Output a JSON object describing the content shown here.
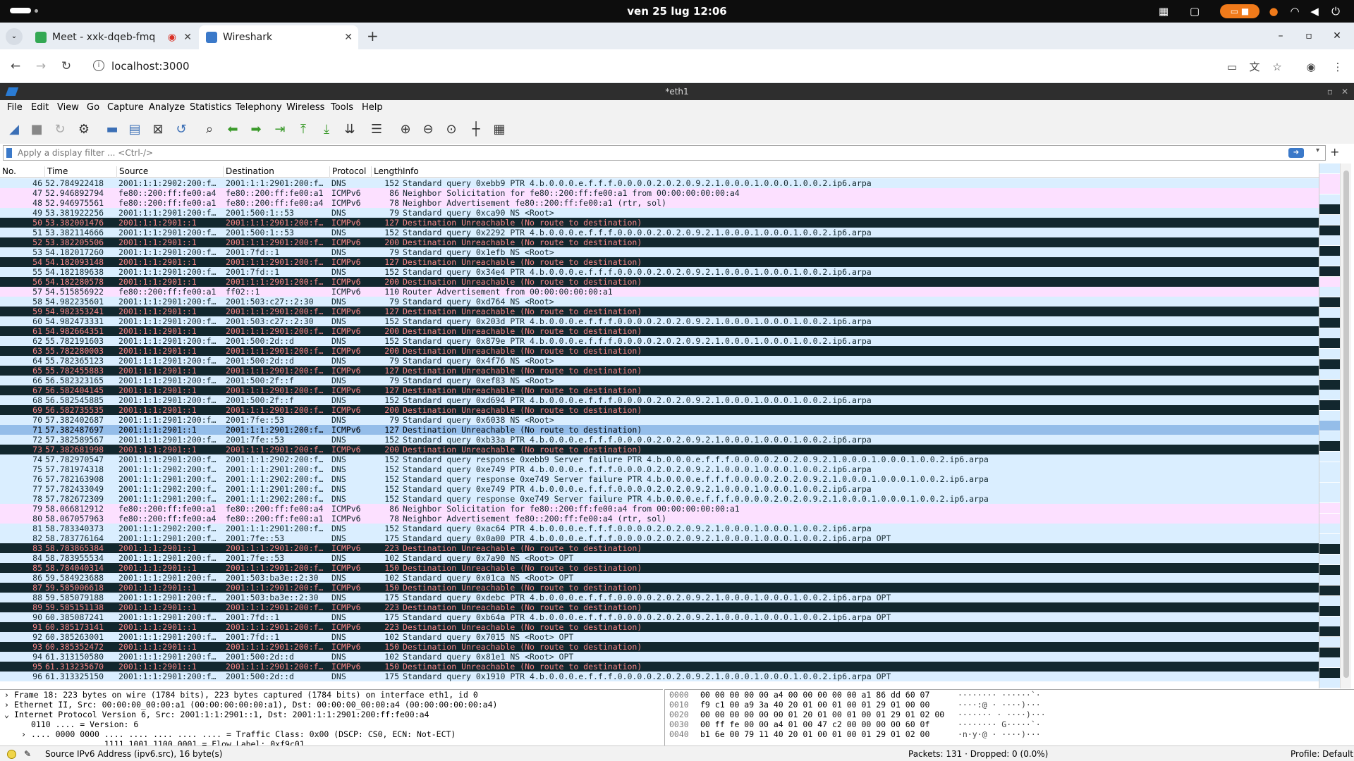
{
  "system": {
    "clock": "ven 25 lug  12:06"
  },
  "browser": {
    "tabs": [
      {
        "label": "Meet - xxk-dqeb-fmq",
        "color": "#34a853",
        "recording": true
      },
      {
        "label": "Wireshark",
        "color": "#3b79c9",
        "recording": false
      }
    ],
    "url": "localhost:3000"
  },
  "wireshark": {
    "title": "*eth1",
    "menu": [
      "File",
      "Edit",
      "View",
      "Go",
      "Capture",
      "Analyze",
      "Statistics",
      "Telephony",
      "Wireless",
      "Tools",
      "Help"
    ],
    "filter_placeholder": "Apply a display filter ... <Ctrl-/>",
    "columns": [
      "No.",
      "Time",
      "Source",
      "Destination",
      "Protocol",
      "Length",
      "Info"
    ],
    "packets": [
      [
        "46",
        "52.784922418",
        "2001:1:1:2902:200:f…",
        "2001:1:1:2901:200:f…",
        "DNS",
        "152",
        "Standard query 0xebb9 PTR 4.b.0.0.0.e.f.f.f.0.0.0.0.2.0.2.0.9.2.1.0.0.0.1.0.0.0.1.0.0.2.ip6.arpa",
        "dns"
      ],
      [
        "47",
        "52.946892794",
        "fe80::200:ff:fe00:a4",
        "fe80::200:ff:fe00:a1",
        "ICMPv6",
        "86",
        "Neighbor Solicitation for fe80::200:ff:fe00:a1 from 00:00:00:00:00:a4",
        "nd"
      ],
      [
        "48",
        "52.946975561",
        "fe80::200:ff:fe00:a1",
        "fe80::200:ff:fe00:a4",
        "ICMPv6",
        "78",
        "Neighbor Advertisement fe80::200:ff:fe00:a1 (rtr, sol)",
        "nd"
      ],
      [
        "49",
        "53.381922256",
        "2001:1:1:2901:200:f…",
        "2001:500:1::53",
        "DNS",
        "79",
        "Standard query 0xca90 NS <Root>",
        "dns"
      ],
      [
        "50",
        "53.382001476",
        "2001:1:1:2901::1",
        "2001:1:1:2901:200:f…",
        "ICMPv6",
        "127",
        "Destination Unreachable (No route to destination)",
        "icmp"
      ],
      [
        "51",
        "53.382114666",
        "2001:1:1:2901:200:f…",
        "2001:500:1::53",
        "DNS",
        "152",
        "Standard query 0x2292 PTR 4.b.0.0.0.e.f.f.f.0.0.0.0.2.0.2.0.9.2.1.0.0.0.1.0.0.0.1.0.0.2.ip6.arpa",
        "dns"
      ],
      [
        "52",
        "53.382205506",
        "2001:1:1:2901::1",
        "2001:1:1:2901:200:f…",
        "ICMPv6",
        "200",
        "Destination Unreachable (No route to destination)",
        "icmp"
      ],
      [
        "53",
        "54.182017260",
        "2001:1:1:2901:200:f…",
        "2001:7fd::1",
        "DNS",
        "79",
        "Standard query 0x1efb NS <Root>",
        "dns"
      ],
      [
        "54",
        "54.182093148",
        "2001:1:1:2901::1",
        "2001:1:1:2901:200:f…",
        "ICMPv6",
        "127",
        "Destination Unreachable (No route to destination)",
        "icmp"
      ],
      [
        "55",
        "54.182189638",
        "2001:1:1:2901:200:f…",
        "2001:7fd::1",
        "DNS",
        "152",
        "Standard query 0x34e4 PTR 4.b.0.0.0.e.f.f.f.0.0.0.0.2.0.2.0.9.2.1.0.0.0.1.0.0.0.1.0.0.2.ip6.arpa",
        "dns"
      ],
      [
        "56",
        "54.182280578",
        "2001:1:1:2901::1",
        "2001:1:1:2901:200:f…",
        "ICMPv6",
        "200",
        "Destination Unreachable (No route to destination)",
        "icmp"
      ],
      [
        "57",
        "54.515856922",
        "fe80::200:ff:fe00:a1",
        "ff02::1",
        "ICMPv6",
        "110",
        "Router Advertisement from 00:00:00:00:00:a1",
        "nd"
      ],
      [
        "58",
        "54.982235601",
        "2001:1:1:2901:200:f…",
        "2001:503:c27::2:30",
        "DNS",
        "79",
        "Standard query 0xd764 NS <Root>",
        "dns"
      ],
      [
        "59",
        "54.982353241",
        "2001:1:1:2901::1",
        "2001:1:1:2901:200:f…",
        "ICMPv6",
        "127",
        "Destination Unreachable (No route to destination)",
        "icmp"
      ],
      [
        "60",
        "54.982473331",
        "2001:1:1:2901:200:f…",
        "2001:503:c27::2:30",
        "DNS",
        "152",
        "Standard query 0x203d PTR 4.b.0.0.0.e.f.f.f.0.0.0.0.2.0.2.0.9.2.1.0.0.0.1.0.0.0.1.0.0.2.ip6.arpa",
        "dns"
      ],
      [
        "61",
        "54.982664351",
        "2001:1:1:2901::1",
        "2001:1:1:2901:200:f…",
        "ICMPv6",
        "200",
        "Destination Unreachable (No route to destination)",
        "icmp"
      ],
      [
        "62",
        "55.782191603",
        "2001:1:1:2901:200:f…",
        "2001:500:2d::d",
        "DNS",
        "152",
        "Standard query 0x879e PTR 4.b.0.0.0.e.f.f.f.0.0.0.0.2.0.2.0.9.2.1.0.0.0.1.0.0.0.1.0.0.2.ip6.arpa",
        "dns"
      ],
      [
        "63",
        "55.782280003",
        "2001:1:1:2901::1",
        "2001:1:1:2901:200:f…",
        "ICMPv6",
        "200",
        "Destination Unreachable (No route to destination)",
        "icmp"
      ],
      [
        "64",
        "55.782365123",
        "2001:1:1:2901:200:f…",
        "2001:500:2d::d",
        "DNS",
        "79",
        "Standard query 0x4f76 NS <Root>",
        "dns"
      ],
      [
        "65",
        "55.782455883",
        "2001:1:1:2901::1",
        "2001:1:1:2901:200:f…",
        "ICMPv6",
        "127",
        "Destination Unreachable (No route to destination)",
        "icmp"
      ],
      [
        "66",
        "56.582323165",
        "2001:1:1:2901:200:f…",
        "2001:500:2f::f",
        "DNS",
        "79",
        "Standard query 0xef83 NS <Root>",
        "dns"
      ],
      [
        "67",
        "56.582404145",
        "2001:1:1:2901::1",
        "2001:1:1:2901:200:f…",
        "ICMPv6",
        "127",
        "Destination Unreachable (No route to destination)",
        "icmp"
      ],
      [
        "68",
        "56.582545885",
        "2001:1:1:2901:200:f…",
        "2001:500:2f::f",
        "DNS",
        "152",
        "Standard query 0xd694 PTR 4.b.0.0.0.e.f.f.f.0.0.0.0.2.0.2.0.9.2.1.0.0.0.1.0.0.0.1.0.0.2.ip6.arpa",
        "dns"
      ],
      [
        "69",
        "56.582735535",
        "2001:1:1:2901::1",
        "2001:1:1:2901:200:f…",
        "ICMPv6",
        "200",
        "Destination Unreachable (No route to destination)",
        "icmp"
      ],
      [
        "70",
        "57.382402687",
        "2001:1:1:2901:200:f…",
        "2001:7fe::53",
        "DNS",
        "79",
        "Standard query 0x6038 NS <Root>",
        "dns"
      ],
      [
        "71",
        "57.382487697",
        "2001:1:1:2901::1",
        "2001:1:1:2901:200:f…",
        "ICMPv6",
        "127",
        "Destination Unreachable (No route to destination)",
        "sel"
      ],
      [
        "72",
        "57.382589567",
        "2001:1:1:2901:200:f…",
        "2001:7fe::53",
        "DNS",
        "152",
        "Standard query 0xb33a PTR 4.b.0.0.0.e.f.f.f.0.0.0.0.2.0.2.0.9.2.1.0.0.0.1.0.0.0.1.0.0.2.ip6.arpa",
        "dns"
      ],
      [
        "73",
        "57.382681998",
        "2001:1:1:2901::1",
        "2001:1:1:2901:200:f…",
        "ICMPv6",
        "200",
        "Destination Unreachable (No route to destination)",
        "icmp"
      ],
      [
        "74",
        "57.782970547",
        "2001:1:1:2901:200:f…",
        "2001:1:1:2902:200:f…",
        "DNS",
        "152",
        "Standard query response 0xebb9 Server failure PTR 4.b.0.0.0.e.f.f.f.0.0.0.0.2.0.2.0.9.2.1.0.0.0.1.0.0.0.1.0.0.2.ip6.arpa",
        "dns"
      ],
      [
        "75",
        "57.781974318",
        "2001:1:1:2902:200:f…",
        "2001:1:1:2901:200:f…",
        "DNS",
        "152",
        "Standard query 0xe749 PTR 4.b.0.0.0.e.f.f.f.0.0.0.0.2.0.2.0.9.2.1.0.0.0.1.0.0.0.1.0.0.2.ip6.arpa",
        "dns"
      ],
      [
        "76",
        "57.782163908",
        "2001:1:1:2901:200:f…",
        "2001:1:1:2902:200:f…",
        "DNS",
        "152",
        "Standard query response 0xe749 Server failure PTR 4.b.0.0.0.e.f.f.f.0.0.0.0.2.0.2.0.9.2.1.0.0.0.1.0.0.0.1.0.0.2.ip6.arpa",
        "dns"
      ],
      [
        "77",
        "57.782433049",
        "2001:1:1:2902:200:f…",
        "2001:1:1:2901:200:f…",
        "DNS",
        "152",
        "Standard query 0xe749 PTR 4.b.0.0.0.e.f.f.f.0.0.0.0.2.0.2.0.9.2.1.0.0.0.1.0.0.0.1.0.0.2.ip6.arpa",
        "dns"
      ],
      [
        "78",
        "57.782672309",
        "2001:1:1:2901:200:f…",
        "2001:1:1:2902:200:f…",
        "DNS",
        "152",
        "Standard query response 0xe749 Server failure PTR 4.b.0.0.0.e.f.f.f.0.0.0.0.2.0.2.0.9.2.1.0.0.0.1.0.0.0.1.0.0.2.ip6.arpa",
        "dns"
      ],
      [
        "79",
        "58.066812912",
        "fe80::200:ff:fe00:a1",
        "fe80::200:ff:fe00:a4",
        "ICMPv6",
        "86",
        "Neighbor Solicitation for fe80::200:ff:fe00:a4 from 00:00:00:00:00:a1",
        "nd"
      ],
      [
        "80",
        "58.067057963",
        "fe80::200:ff:fe00:a4",
        "fe80::200:ff:fe00:a1",
        "ICMPv6",
        "78",
        "Neighbor Advertisement fe80::200:ff:fe00:a4 (rtr, sol)",
        "nd"
      ],
      [
        "81",
        "58.783340373",
        "2001:1:1:2902:200:f…",
        "2001:1:1:2901:200:f…",
        "DNS",
        "152",
        "Standard query 0xac64 PTR 4.b.0.0.0.e.f.f.f.0.0.0.0.2.0.2.0.9.2.1.0.0.0.1.0.0.0.1.0.0.2.ip6.arpa",
        "dns"
      ],
      [
        "82",
        "58.783776164",
        "2001:1:1:2901:200:f…",
        "2001:7fe::53",
        "DNS",
        "175",
        "Standard query 0x0a00 PTR 4.b.0.0.0.e.f.f.f.0.0.0.0.2.0.2.0.9.2.1.0.0.0.1.0.0.0.1.0.0.2.ip6.arpa OPT",
        "dns"
      ],
      [
        "83",
        "58.783865384",
        "2001:1:1:2901::1",
        "2001:1:1:2901:200:f…",
        "ICMPv6",
        "223",
        "Destination Unreachable (No route to destination)",
        "icmp"
      ],
      [
        "84",
        "58.783955534",
        "2001:1:1:2901:200:f…",
        "2001:7fe::53",
        "DNS",
        "102",
        "Standard query 0x7a90 NS <Root> OPT",
        "dns"
      ],
      [
        "85",
        "58.784040314",
        "2001:1:1:2901::1",
        "2001:1:1:2901:200:f…",
        "ICMPv6",
        "150",
        "Destination Unreachable (No route to destination)",
        "icmp"
      ],
      [
        "86",
        "59.584923688",
        "2001:1:1:2901:200:f…",
        "2001:503:ba3e::2:30",
        "DNS",
        "102",
        "Standard query 0x01ca NS <Root> OPT",
        "dns"
      ],
      [
        "87",
        "59.585006618",
        "2001:1:1:2901::1",
        "2001:1:1:2901:200:f…",
        "ICMPv6",
        "150",
        "Destination Unreachable (No route to destination)",
        "icmp"
      ],
      [
        "88",
        "59.585079188",
        "2001:1:1:2901:200:f…",
        "2001:503:ba3e::2:30",
        "DNS",
        "175",
        "Standard query 0xdebc PTR 4.b.0.0.0.e.f.f.f.0.0.0.0.2.0.2.0.9.2.1.0.0.0.1.0.0.0.1.0.0.2.ip6.arpa OPT",
        "dns"
      ],
      [
        "89",
        "59.585151138",
        "2001:1:1:2901::1",
        "2001:1:1:2901:200:f…",
        "ICMPv6",
        "223",
        "Destination Unreachable (No route to destination)",
        "icmp"
      ],
      [
        "90",
        "60.385087241",
        "2001:1:1:2901:200:f…",
        "2001:7fd::1",
        "DNS",
        "175",
        "Standard query 0xb64a PTR 4.b.0.0.0.e.f.f.f.0.0.0.0.2.0.2.0.9.2.1.0.0.0.1.0.0.0.1.0.0.2.ip6.arpa OPT",
        "dns"
      ],
      [
        "91",
        "60.385173141",
        "2001:1:1:2901::1",
        "2001:1:1:2901:200:f…",
        "ICMPv6",
        "223",
        "Destination Unreachable (No route to destination)",
        "icmp"
      ],
      [
        "92",
        "60.385263001",
        "2001:1:1:2901:200:f…",
        "2001:7fd::1",
        "DNS",
        "102",
        "Standard query 0x7015 NS <Root> OPT",
        "dns"
      ],
      [
        "93",
        "60.385352472",
        "2001:1:1:2901::1",
        "2001:1:1:2901:200:f…",
        "ICMPv6",
        "150",
        "Destination Unreachable (No route to destination)",
        "icmp"
      ],
      [
        "94",
        "61.313150580",
        "2001:1:1:2901:200:f…",
        "2001:500:2d::d",
        "DNS",
        "102",
        "Standard query 0x81e1 NS <Root> OPT",
        "dns"
      ],
      [
        "95",
        "61.313235670",
        "2001:1:1:2901::1",
        "2001:1:1:2901:200:f…",
        "ICMPv6",
        "150",
        "Destination Unreachable (No route to destination)",
        "icmp"
      ],
      [
        "96",
        "61.313325150",
        "2001:1:1:2901:200:f…",
        "2001:500:2d::d",
        "DNS",
        "175",
        "Standard query 0x1910 PTR 4.b.0.0.0.e.f.f.f.0.0.0.0.2.0.2.0.9.2.1.0.0.0.1.0.0.0.1.0.0.2.ip6.arpa OPT",
        "dns"
      ]
    ],
    "detail": [
      {
        "arrow": "›",
        "text": "Frame 18: 223 bytes on wire (1784 bits), 223 bytes captured (1784 bits) on interface eth1, id 0",
        "indent": 0
      },
      {
        "arrow": "›",
        "text": "Ethernet II, Src: 00:00:00_00:00:a1 (00:00:00:00:00:a1), Dst: 00:00:00_00:00:a4 (00:00:00:00:00:a4)",
        "indent": 0
      },
      {
        "arrow": "⌄",
        "text": "Internet Protocol Version 6, Src: 2001:1:1:2901::1, Dst: 2001:1:1:2901:200:ff:fe00:a4",
        "indent": 0
      },
      {
        "arrow": "",
        "text": "0110 .... = Version: 6",
        "indent": 1
      },
      {
        "arrow": "›",
        "text": ".... 0000 0000 .... .... .... .... .... = Traffic Class: 0x00 (DSCP: CS0, ECN: Not-ECT)",
        "indent": 1
      },
      {
        "arrow": "",
        "text": ".... .... .... 1111 1001 1100 0001 = Flow Label: 0xf9c01",
        "indent": 1
      }
    ],
    "hex": [
      {
        "off": "0000",
        "bytes": "00 00 00 00 00 a4 00 00  00 00 00 a1 86 dd 60 07",
        "ascii": "········ ······`·"
      },
      {
        "off": "0010",
        "bytes": "f9 c1 00 a9 3a 40 20 01  00 01 00 01 29 01 00 00",
        "ascii": "····:@ · ····)···"
      },
      {
        "off": "0020",
        "bytes": "00 00 00 00 00 00 01 20 01  00 01 00 01 29 01 02 00",
        "ascii": "······· · ····)···"
      },
      {
        "off": "0030",
        "bytes": "00 ff fe 00 00 a4 01 00  47 c2 00 00 00 00 60 0f",
        "ascii": "········ G·····`·"
      },
      {
        "off": "0040",
        "bytes": "b1 6e 00 79 11 40 20 01  00 01 00 01 29 01 02 00",
        "ascii": "·n·y·@ · ····)···"
      }
    ],
    "status": {
      "field": "Source IPv6 Address (ipv6.src), 16 byte(s)",
      "packets": "Packets: 131 · Dropped: 0 (0.0%)",
      "profile": "Profile: Default"
    },
    "row_colors": {
      "dns": "#daeeff",
      "icmp": "#12272e",
      "nd": "#fce0ff",
      "sel": "#94bde9"
    }
  }
}
